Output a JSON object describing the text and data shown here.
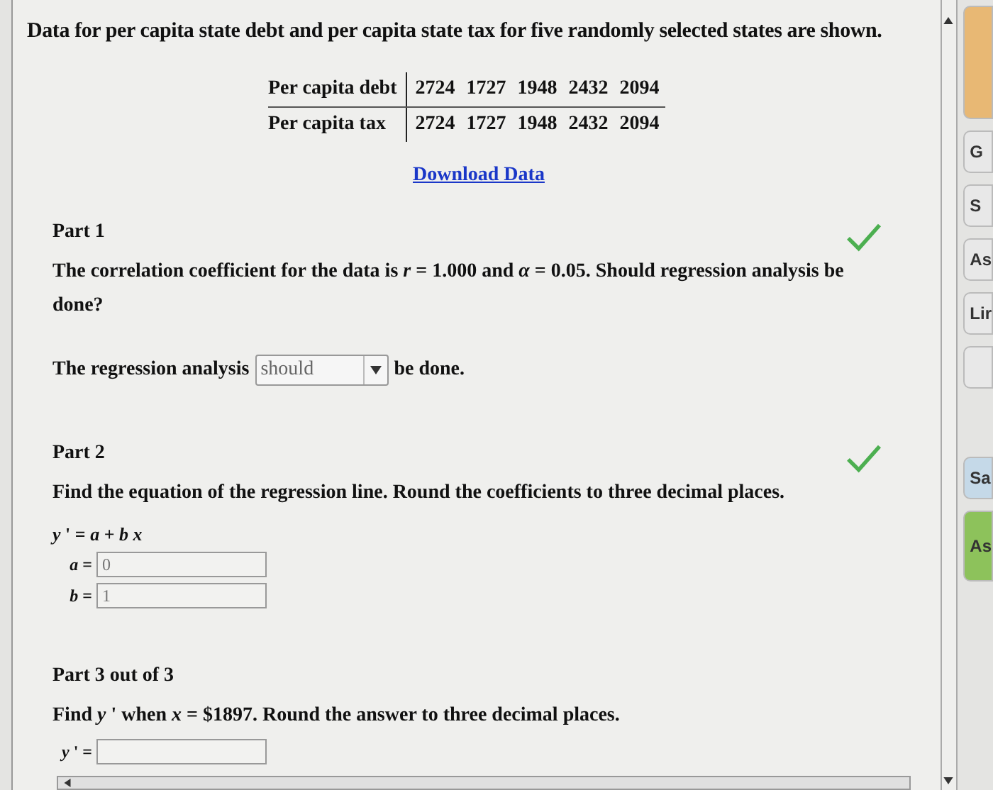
{
  "intro": "Data for per capita state debt and per capita state tax for five randomly selected states are shown.",
  "table": {
    "rows": [
      {
        "label": "Per capita debt",
        "values": [
          "2724",
          "1727",
          "1948",
          "2432",
          "2094"
        ]
      },
      {
        "label": "Per capita tax",
        "values": [
          "2724",
          "1727",
          "1948",
          "2432",
          "2094"
        ]
      }
    ]
  },
  "download_link": "Download Data",
  "parts": [
    {
      "title": "Part 1",
      "prompt": "The correlation coefficient for the data is *r* = 1.000 and *α* = 0.05. Should regression analysis be done?",
      "correct": true,
      "answer": {
        "kind": "dropdown",
        "before": "The regression analysis",
        "value": "should",
        "after": "be done."
      }
    },
    {
      "title": "Part 2",
      "prompt": "Find the equation of the regression line. Round the coefficients to three decimal places.",
      "correct": true,
      "equation": "*y* ' = *a* + *b* *x*",
      "answer": {
        "kind": "fields",
        "fields": [
          {
            "label": "*a* =",
            "value": "0"
          },
          {
            "label": "*b* =",
            "value": "1"
          }
        ]
      }
    },
    {
      "title": "Part 3 out of 3",
      "prompt": "Find *y* ' when *x* = $1897. Round the answer to three decimal places.",
      "correct": false,
      "answer": {
        "kind": "fields",
        "fields": [
          {
            "label": "*y* ' ="
          }
        ]
      }
    }
  ],
  "side_buttons": [
    {
      "kind": "accent"
    },
    {
      "kind": "plain",
      "label": "G"
    },
    {
      "kind": "plain",
      "label": "S"
    },
    {
      "kind": "plain",
      "label": "As"
    },
    {
      "kind": "plain",
      "label": "Lir"
    },
    {
      "kind": "plain"
    },
    {
      "kind": "save",
      "label": "Sa"
    },
    {
      "kind": "submit",
      "label": "As"
    }
  ]
}
